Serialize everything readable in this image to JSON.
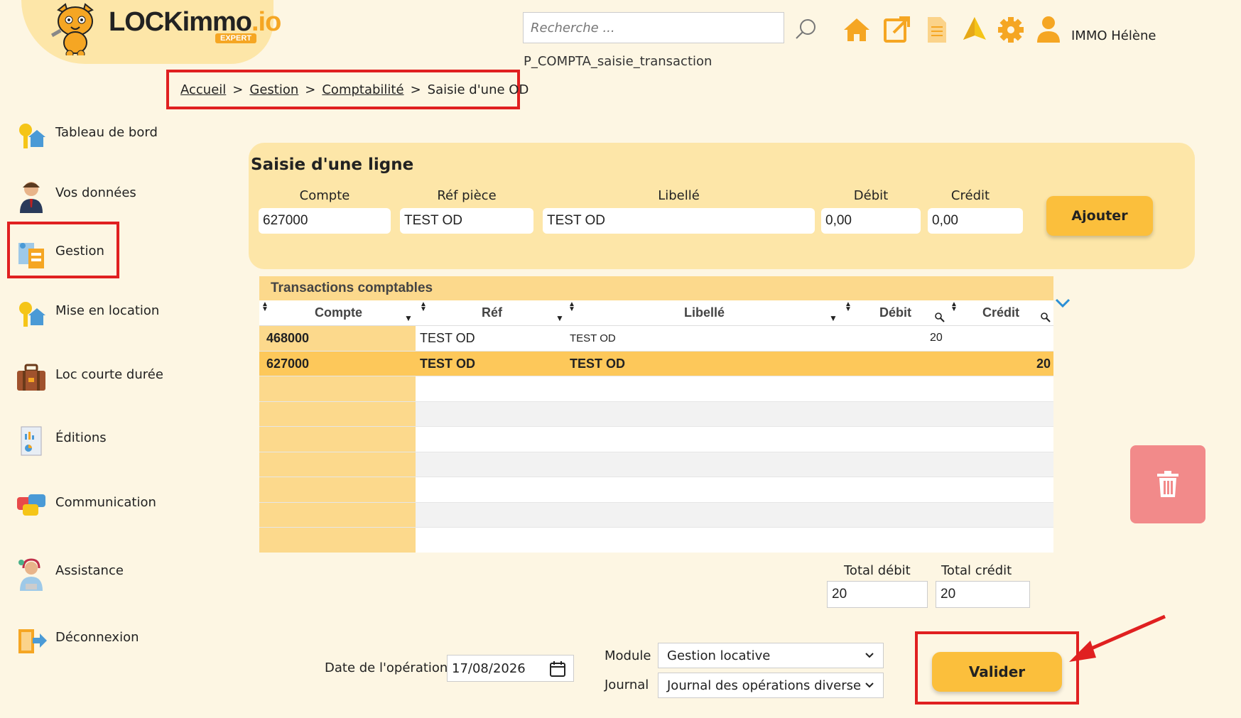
{
  "app": {
    "logo_text_main": "LOCKimmo",
    "logo_text_suffix": ".io",
    "logo_badge": "EXPERT"
  },
  "header": {
    "search_placeholder": "Recherche ...",
    "user_name": "IMMO Hélène",
    "screen_code": "P_COMPTA_saisie_transaction",
    "icons": [
      "home-icon",
      "external-link-icon",
      "document-icon",
      "alert-icon",
      "gear-icon",
      "user-icon"
    ]
  },
  "breadcrumb": {
    "items": [
      "Accueil",
      "Gestion",
      "Comptabilité"
    ],
    "separator": ">",
    "current": "Saisie d'une OD"
  },
  "sidebar": {
    "items": [
      {
        "label": "Tableau de bord",
        "icon": "keys-house-icon"
      },
      {
        "label": "Vos données",
        "icon": "person-icon"
      },
      {
        "label": "Gestion",
        "icon": "management-icon"
      },
      {
        "label": "Mise en location",
        "icon": "keys-house-icon"
      },
      {
        "label": "Loc courte durée",
        "icon": "suitcase-icon"
      },
      {
        "label": "Éditions",
        "icon": "report-icon"
      },
      {
        "label": "Communication",
        "icon": "chat-bubbles-icon"
      },
      {
        "label": "Assistance",
        "icon": "support-agent-icon"
      },
      {
        "label": "Déconnexion",
        "icon": "logout-icon"
      }
    ],
    "highlighted": "Gestion"
  },
  "entry": {
    "title": "Saisie d'une ligne",
    "labels": {
      "compte": "Compte",
      "ref": "Réf pièce",
      "libelle": "Libellé",
      "debit": "Débit",
      "credit": "Crédit"
    },
    "values": {
      "compte": "627000",
      "ref": "TEST OD",
      "libelle": "TEST OD",
      "debit": "0,00",
      "credit": "0,00"
    },
    "add_button": "Ajouter"
  },
  "table": {
    "title": "Transactions comptables",
    "columns": [
      "Compte",
      "Réf",
      "Libellé",
      "Débit",
      "Crédit"
    ],
    "rows": [
      {
        "compte": "468000",
        "ref": "TEST OD",
        "libelle": "TEST OD",
        "debit": "20",
        "credit": ""
      },
      {
        "compte": "627000",
        "ref": "TEST OD",
        "libelle": "TEST OD",
        "debit": "",
        "credit": "20"
      }
    ],
    "selected_row": 1,
    "empty_rows": 7
  },
  "totals": {
    "debit_label": "Total débit",
    "credit_label": "Total crédit",
    "debit": "20",
    "credit": "20"
  },
  "footer": {
    "date_label": "Date de l'opération",
    "date_value": "17/08/2026",
    "module_label": "Module",
    "module_value": "Gestion locative",
    "journal_label": "Journal",
    "journal_value": "Journal des opérations diverse",
    "validate_button": "Valider"
  },
  "colors": {
    "background": "#fdf6e3",
    "panel": "#fde6a8",
    "accent": "#fbbf3c",
    "selected_row": "#fdc85a",
    "highlight_border": "#e02020",
    "delete": "#f28a8a"
  }
}
